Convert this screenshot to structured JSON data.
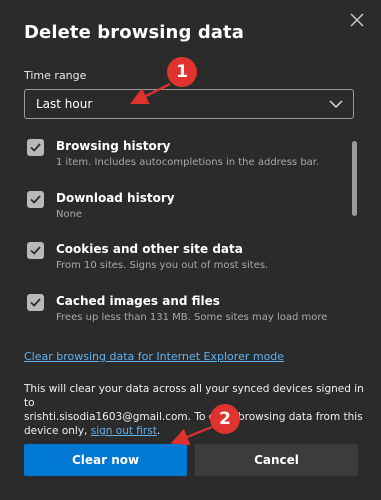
{
  "dialog": {
    "title": "Delete browsing data",
    "close_icon": "close-icon"
  },
  "time_range": {
    "label": "Time range",
    "selected": "Last hour",
    "dropdown_icon": "chevron-down-icon"
  },
  "options": [
    {
      "title": "Browsing history",
      "description": "1 item. Includes autocompletions in the address bar.",
      "checked": true
    },
    {
      "title": "Download history",
      "description": "None",
      "checked": true
    },
    {
      "title": "Cookies and other site data",
      "description": "From 10 sites. Signs you out of most sites.",
      "checked": true
    },
    {
      "title": "Cached images and files",
      "description": "Frees up less than 131 MB. Some sites may load more",
      "checked": true
    }
  ],
  "ie_link": "Clear browsing data for Internet Explorer mode",
  "info": {
    "line1": "This will clear your data across all your synced devices signed in to",
    "line2": "srishti.sisodia1603@gmail.com. To clear browsing data from this",
    "line3_prefix": "device only, ",
    "sign_out": "sign out first",
    "line3_suffix": "."
  },
  "buttons": {
    "clear_now": "Clear now",
    "cancel": "Cancel"
  },
  "annotations": {
    "badge_1": "1",
    "badge_2": "2",
    "color": "#e0322e"
  },
  "colors": {
    "background": "#2b2b2b",
    "accent": "#0078d4",
    "link": "#5fb2f0"
  }
}
